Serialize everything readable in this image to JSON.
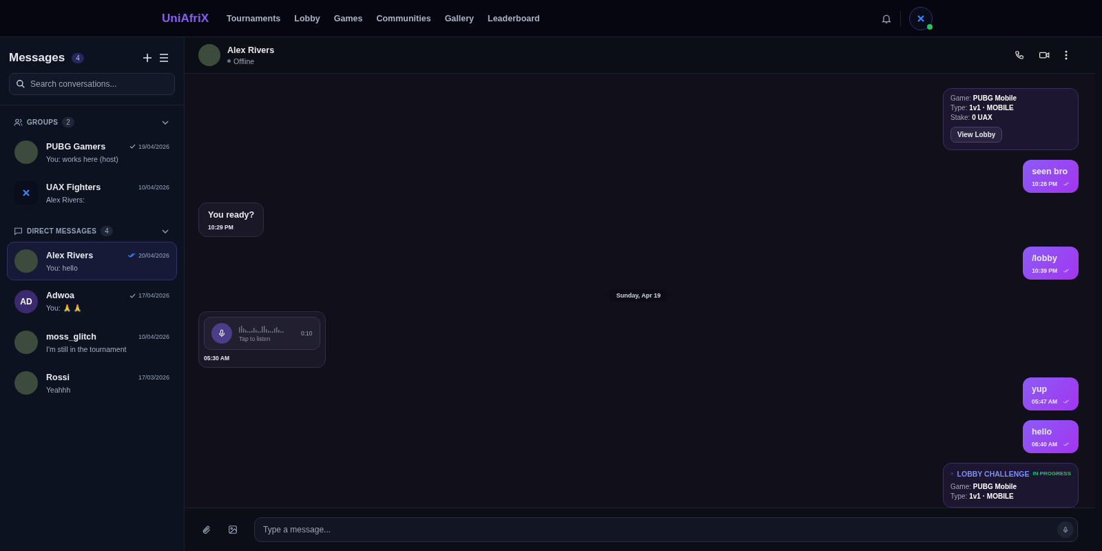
{
  "nav": {
    "logo": "UniAfriX",
    "links": [
      "Tournaments",
      "Lobby",
      "Games",
      "Communities",
      "Gallery",
      "Leaderboard"
    ],
    "online": true
  },
  "sidebar": {
    "title": "Messages",
    "count": "4",
    "search": {
      "placeholder": "Search conversations..."
    },
    "sections": [
      {
        "kind": "groups",
        "label": "GROUPS",
        "count": "2",
        "expanded": true,
        "items": [
          {
            "kind": "photo",
            "name": "PUBG Gamers",
            "preview": "You: works here (host)",
            "date": "19/04/2026",
            "sent": true,
            "read": false,
            "selected": false
          },
          {
            "kind": "logo",
            "name": "UAX Fighters",
            "preview": "Alex Rivers:",
            "date": "10/04/2026",
            "sent": false,
            "read": false,
            "selected": false
          }
        ]
      },
      {
        "kind": "direct",
        "label": "DIRECT MESSAGES",
        "count": "4",
        "expanded": true,
        "items": [
          {
            "kind": "photo",
            "name": "Alex Rivers",
            "preview": "You: hello",
            "date": "20/04/2026",
            "sent": true,
            "read": true,
            "selected": true
          },
          {
            "kind": "initials",
            "initials": "AD",
            "name": "Adwoa",
            "preview": "You: 🙏 🙏",
            "date": "17/04/2026",
            "sent": true,
            "read": false,
            "selected": false
          },
          {
            "kind": "photo",
            "name": "moss_glitch",
            "preview": "I'm still in the tournament",
            "date": "10/04/2026",
            "sent": false,
            "read": false,
            "selected": false
          },
          {
            "kind": "photo",
            "name": "Rossi",
            "preview": "Yeahhh",
            "date": "17/03/2026",
            "sent": false,
            "read": false,
            "selected": false
          }
        ]
      }
    ]
  },
  "chat": {
    "name": "Alex Rivers",
    "status": "Offline",
    "online": false,
    "messages": [
      {
        "kind": "lobby",
        "outgoing": true,
        "lines": [
          {
            "label": "Game:",
            "value": "PUBG Mobile"
          },
          {
            "label": "Type:",
            "value": "1v1 · MOBILE"
          },
          {
            "label": "Stake:",
            "value": "0 UAX"
          }
        ],
        "button": "View Lobby"
      },
      {
        "kind": "text",
        "outgoing": true,
        "text": "seen bro",
        "time": "10:28 PM",
        "read": true
      },
      {
        "kind": "text",
        "outgoing": false,
        "text": "You ready?",
        "time": "10:29 PM"
      },
      {
        "kind": "text",
        "outgoing": true,
        "text": "/lobby",
        "time": "10:39 PM",
        "read": true
      },
      {
        "kind": "date",
        "text": "Sunday, Apr 19"
      },
      {
        "kind": "voice",
        "outgoing": false,
        "hint": "Tap to listen",
        "duration": "0:10",
        "time": "05:30 AM"
      },
      {
        "kind": "text",
        "outgoing": true,
        "text": "yup",
        "time": "05:47 AM",
        "read": true
      },
      {
        "kind": "text",
        "outgoing": true,
        "text": "hello",
        "time": "06:40 AM",
        "read": true
      },
      {
        "kind": "lobby",
        "outgoing": true,
        "title": "LOBBY CHALLENGE",
        "status": "IN PROGRESS",
        "lines": [
          {
            "label": "Game:",
            "value": "PUBG Mobile"
          },
          {
            "label": "Type:",
            "value": "1v1 · MOBILE"
          }
        ]
      }
    ],
    "composer": {
      "placeholder": "Type a message..."
    }
  }
}
